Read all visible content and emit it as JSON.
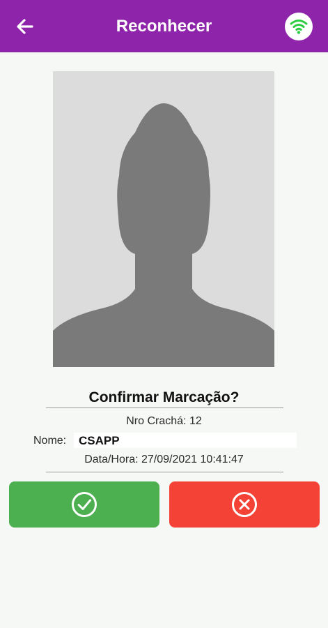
{
  "app_bar": {
    "title": "Reconhecer",
    "back_icon": "arrow-left-icon",
    "status_icon": "wifi-icon",
    "color": "#8e24aa",
    "wifi_color": "#2ecc40"
  },
  "dialog": {
    "question": "Confirmar Marcação?",
    "badge_line": "Nro Crachá: 12",
    "name_label": "Nome:",
    "name_value": "CSAPP",
    "datetime_line": "Data/Hora: 27/09/2021 10:41:47"
  },
  "actions": {
    "confirm_icon": "check-circle-icon",
    "cancel_icon": "x-circle-icon",
    "confirm_color": "#4caf50",
    "cancel_color": "#f44336"
  }
}
